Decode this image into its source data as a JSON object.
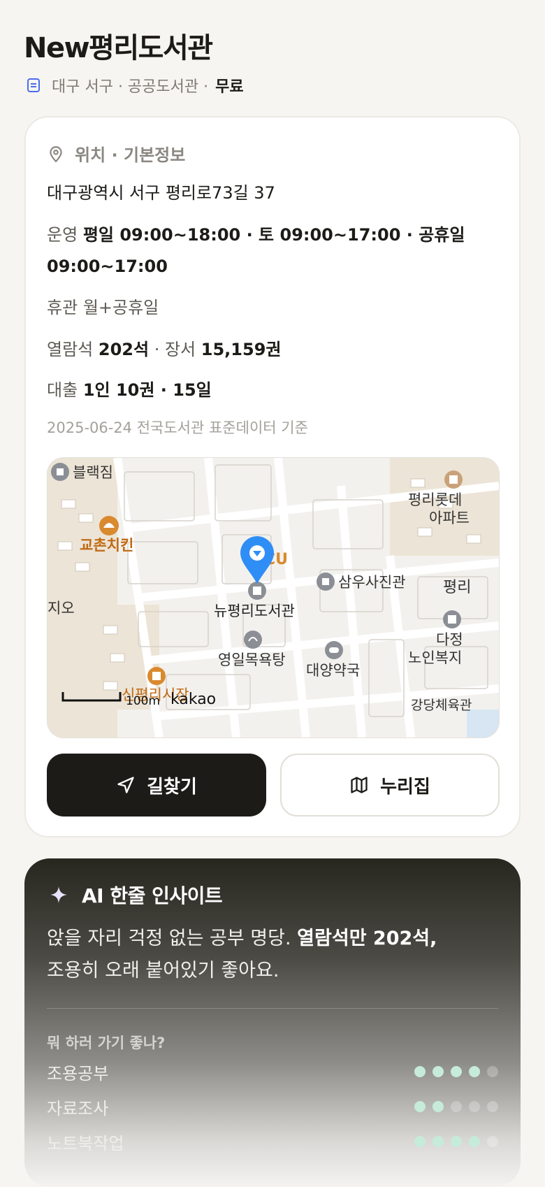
{
  "header": {
    "title": "New평리도서관",
    "meta": "대구 서구 · 공공도서관 ·",
    "fee": "무료"
  },
  "info": {
    "section_label": "위치 · 기본정보",
    "address": "대구광역시 서구 평리로73길 37",
    "hours_label": "운영",
    "hours_value": "평일 09:00~18:00 · 토 09:00~17:00 · 공휴일 09:00~17:00",
    "closed_label": "휴관",
    "closed_value": "월+공휴일",
    "seats_label": "열람석",
    "seats_value": "202석",
    "books_label": "· 장서",
    "books_value": "15,159권",
    "loan_label": "대출",
    "loan_value": "1인 10권 · 15일",
    "source": "2025-06-24 전국도서관 표준데이터 기준"
  },
  "map": {
    "labels": {
      "blackzim": "블랙짐",
      "kyochon": "교촌치킨",
      "library": "뉴평리도서관",
      "samwoo": "삼우사진관",
      "bath": "영일목욕탕",
      "pharmacy": "대양약국",
      "apt_line1": "평리롯데",
      "apt_line2": "아파트",
      "pyeongri": "평리",
      "dajeong1": "다정",
      "dajeong2": "노인복지",
      "gangdang": "강당체육관",
      "jio": "지오",
      "cu": "CU",
      "market": "신평리시장",
      "scale": "100m",
      "brand": "kakao"
    },
    "colors": {
      "pin": "#2f8ef5",
      "poi_orange": "#d9892e",
      "poi_gray": "#8b8f95"
    }
  },
  "actions": {
    "directions": "길찾기",
    "website": "누리집"
  },
  "ai": {
    "title": "AI 한줄 인사이트",
    "text_part1": "앉을 자리 걱정 없는 공부 명당.",
    "text_bold": "열람석만 202석,",
    "text_part2": "조용히 오래 붙어있기 좋아요.",
    "question": "뭐 하러 가기 좋나?",
    "activities": [
      {
        "label": "조용공부",
        "score": 4
      },
      {
        "label": "자료조사",
        "score": 2
      },
      {
        "label": "노트북작업",
        "score": 4
      }
    ]
  }
}
